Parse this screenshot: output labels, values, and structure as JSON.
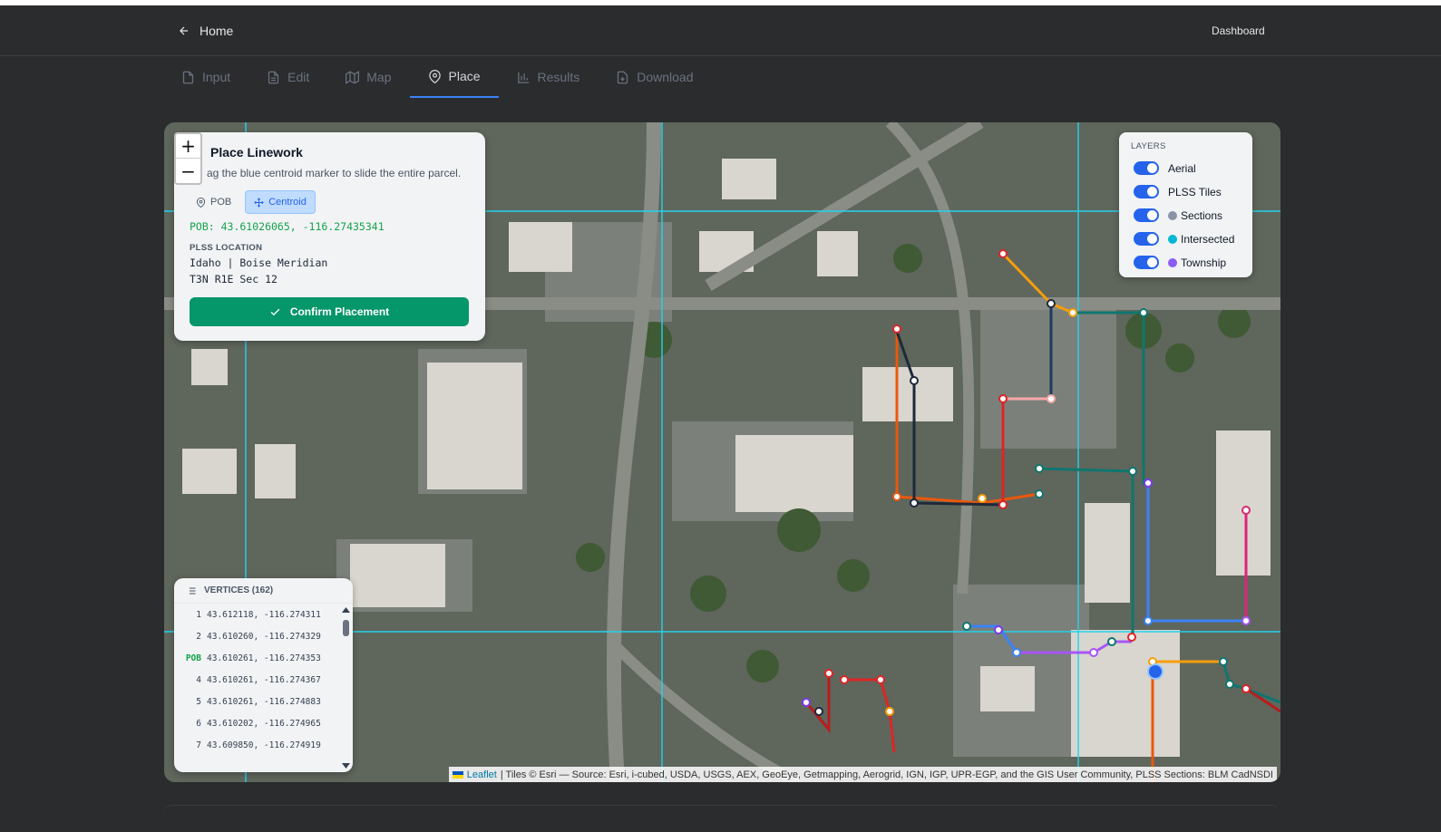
{
  "header": {
    "home_label": "Home",
    "dashboard_label": "Dashboard"
  },
  "tabs": [
    {
      "label": "Input",
      "icon": "file-icon"
    },
    {
      "label": "Edit",
      "icon": "file-text-icon"
    },
    {
      "label": "Map",
      "icon": "map-icon"
    },
    {
      "label": "Place",
      "icon": "map-pin-icon",
      "active": true
    },
    {
      "label": "Results",
      "icon": "bar-chart-icon"
    },
    {
      "label": "Download",
      "icon": "file-download-icon"
    }
  ],
  "zoom": {
    "in": "+",
    "out": "−"
  },
  "place_panel": {
    "title": "Place Linework",
    "subtitle": "ag the blue centroid marker to slide the entire parcel.",
    "pob_button": "POB",
    "centroid_button": "Centroid",
    "pob_coords": "POB: 43.61026065, -116.27435341",
    "plss_label": "PLSS LOCATION",
    "plss_line1": "Idaho | Boise Meridian",
    "plss_line2": "T3N R1E Sec 12",
    "confirm_label": "Confirm Placement"
  },
  "layers": {
    "title": "LAYERS",
    "items": [
      {
        "label": "Aerial",
        "on": true,
        "color": null
      },
      {
        "label": "PLSS Tiles",
        "on": true,
        "color": null
      },
      {
        "label": "Sections",
        "on": true,
        "color": "#8a94a6"
      },
      {
        "label": "Intersected",
        "on": true,
        "color": "#06b6d4"
      },
      {
        "label": "Township",
        "on": true,
        "color": "#8b5cf6"
      }
    ]
  },
  "vertices": {
    "title": "VERTICES (162)",
    "rows": [
      {
        "idx": "1",
        "coords": "43.612118, -116.274311"
      },
      {
        "idx": "2",
        "coords": "43.610260, -116.274329"
      },
      {
        "idx": "POB",
        "coords": "43.610261, -116.274353"
      },
      {
        "idx": "4",
        "coords": "43.610261, -116.274367"
      },
      {
        "idx": "5",
        "coords": "43.610261, -116.274883"
      },
      {
        "idx": "6",
        "coords": "43.610202, -116.274965"
      },
      {
        "idx": "7",
        "coords": "43.609850, -116.274919"
      }
    ]
  },
  "attribution": {
    "leaflet": "Leaflet",
    "text": "| Tiles © Esri — Source: Esri, i-cubed, USDA, USGS, AEX, GeoEye, Getmapping, Aerogrid, IGN, IGP, UPR-EGP, and the GIS User Community, PLSS Sections: BLM CadNSDI"
  },
  "colors": {
    "accent": "#3b82f6",
    "confirm": "#059669",
    "plss_grid": "#22d3ee",
    "pob_text": "#16a34a"
  }
}
